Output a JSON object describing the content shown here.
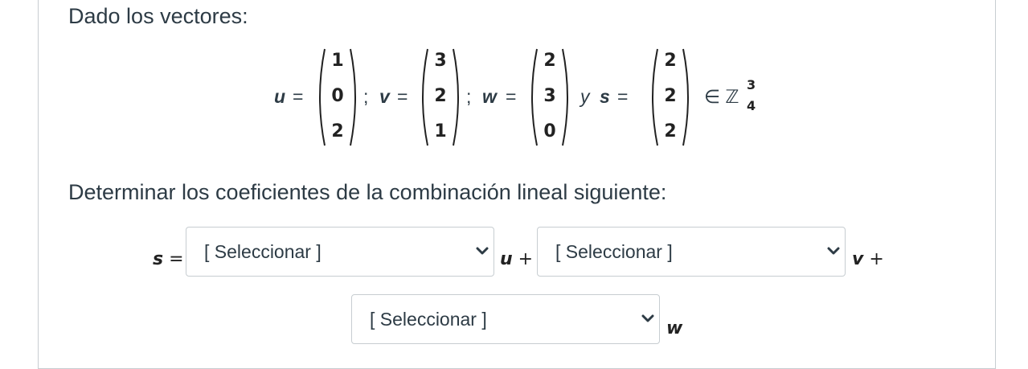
{
  "question": {
    "intro": "Dado los vectores:",
    "instruction": "Determinar los coeficientes de la combinación lineal siguiente:"
  },
  "vectors": {
    "u": {
      "name": "u",
      "values": [
        "1",
        "0",
        "2"
      ]
    },
    "v": {
      "name": "v",
      "values": [
        "3",
        "2",
        "1"
      ]
    },
    "w": {
      "name": "w",
      "values": [
        "2",
        "3",
        "0"
      ]
    },
    "s": {
      "name": "s",
      "values": [
        "2",
        "2",
        "2"
      ]
    }
  },
  "math_text": {
    "equals": "=",
    "sep": ";",
    "conj": "y",
    "in_set": "∈ ℤ",
    "set_sup": "3",
    "set_sub": "4"
  },
  "equation": {
    "lhs": "s",
    "equals": "=",
    "term1_var": "u",
    "term2_var": "v",
    "term3_var": "w",
    "plus": "+"
  },
  "selects": {
    "coef_u": {
      "value": "[ Seleccionar ]"
    },
    "coef_v": {
      "value": "[ Seleccionar ]"
    },
    "coef_w": {
      "value": "[ Seleccionar ]"
    }
  },
  "icons": {
    "dropdown": "chevron-down-icon"
  }
}
